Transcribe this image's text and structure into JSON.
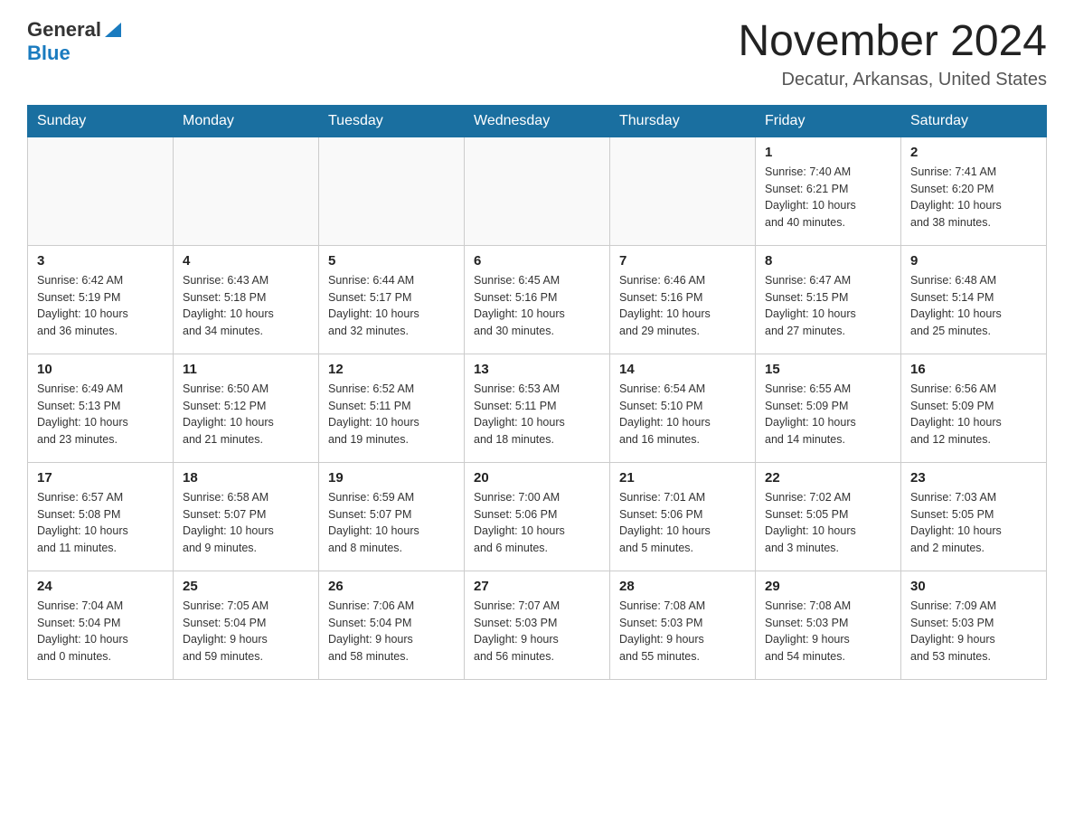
{
  "header": {
    "logo_general": "General",
    "logo_blue": "Blue",
    "title": "November 2024",
    "subtitle": "Decatur, Arkansas, United States"
  },
  "days_of_week": [
    "Sunday",
    "Monday",
    "Tuesday",
    "Wednesday",
    "Thursday",
    "Friday",
    "Saturday"
  ],
  "weeks": [
    [
      {
        "day": "",
        "info": ""
      },
      {
        "day": "",
        "info": ""
      },
      {
        "day": "",
        "info": ""
      },
      {
        "day": "",
        "info": ""
      },
      {
        "day": "",
        "info": ""
      },
      {
        "day": "1",
        "info": "Sunrise: 7:40 AM\nSunset: 6:21 PM\nDaylight: 10 hours\nand 40 minutes."
      },
      {
        "day": "2",
        "info": "Sunrise: 7:41 AM\nSunset: 6:20 PM\nDaylight: 10 hours\nand 38 minutes."
      }
    ],
    [
      {
        "day": "3",
        "info": "Sunrise: 6:42 AM\nSunset: 5:19 PM\nDaylight: 10 hours\nand 36 minutes."
      },
      {
        "day": "4",
        "info": "Sunrise: 6:43 AM\nSunset: 5:18 PM\nDaylight: 10 hours\nand 34 minutes."
      },
      {
        "day": "5",
        "info": "Sunrise: 6:44 AM\nSunset: 5:17 PM\nDaylight: 10 hours\nand 32 minutes."
      },
      {
        "day": "6",
        "info": "Sunrise: 6:45 AM\nSunset: 5:16 PM\nDaylight: 10 hours\nand 30 minutes."
      },
      {
        "day": "7",
        "info": "Sunrise: 6:46 AM\nSunset: 5:16 PM\nDaylight: 10 hours\nand 29 minutes."
      },
      {
        "day": "8",
        "info": "Sunrise: 6:47 AM\nSunset: 5:15 PM\nDaylight: 10 hours\nand 27 minutes."
      },
      {
        "day": "9",
        "info": "Sunrise: 6:48 AM\nSunset: 5:14 PM\nDaylight: 10 hours\nand 25 minutes."
      }
    ],
    [
      {
        "day": "10",
        "info": "Sunrise: 6:49 AM\nSunset: 5:13 PM\nDaylight: 10 hours\nand 23 minutes."
      },
      {
        "day": "11",
        "info": "Sunrise: 6:50 AM\nSunset: 5:12 PM\nDaylight: 10 hours\nand 21 minutes."
      },
      {
        "day": "12",
        "info": "Sunrise: 6:52 AM\nSunset: 5:11 PM\nDaylight: 10 hours\nand 19 minutes."
      },
      {
        "day": "13",
        "info": "Sunrise: 6:53 AM\nSunset: 5:11 PM\nDaylight: 10 hours\nand 18 minutes."
      },
      {
        "day": "14",
        "info": "Sunrise: 6:54 AM\nSunset: 5:10 PM\nDaylight: 10 hours\nand 16 minutes."
      },
      {
        "day": "15",
        "info": "Sunrise: 6:55 AM\nSunset: 5:09 PM\nDaylight: 10 hours\nand 14 minutes."
      },
      {
        "day": "16",
        "info": "Sunrise: 6:56 AM\nSunset: 5:09 PM\nDaylight: 10 hours\nand 12 minutes."
      }
    ],
    [
      {
        "day": "17",
        "info": "Sunrise: 6:57 AM\nSunset: 5:08 PM\nDaylight: 10 hours\nand 11 minutes."
      },
      {
        "day": "18",
        "info": "Sunrise: 6:58 AM\nSunset: 5:07 PM\nDaylight: 10 hours\nand 9 minutes."
      },
      {
        "day": "19",
        "info": "Sunrise: 6:59 AM\nSunset: 5:07 PM\nDaylight: 10 hours\nand 8 minutes."
      },
      {
        "day": "20",
        "info": "Sunrise: 7:00 AM\nSunset: 5:06 PM\nDaylight: 10 hours\nand 6 minutes."
      },
      {
        "day": "21",
        "info": "Sunrise: 7:01 AM\nSunset: 5:06 PM\nDaylight: 10 hours\nand 5 minutes."
      },
      {
        "day": "22",
        "info": "Sunrise: 7:02 AM\nSunset: 5:05 PM\nDaylight: 10 hours\nand 3 minutes."
      },
      {
        "day": "23",
        "info": "Sunrise: 7:03 AM\nSunset: 5:05 PM\nDaylight: 10 hours\nand 2 minutes."
      }
    ],
    [
      {
        "day": "24",
        "info": "Sunrise: 7:04 AM\nSunset: 5:04 PM\nDaylight: 10 hours\nand 0 minutes."
      },
      {
        "day": "25",
        "info": "Sunrise: 7:05 AM\nSunset: 5:04 PM\nDaylight: 9 hours\nand 59 minutes."
      },
      {
        "day": "26",
        "info": "Sunrise: 7:06 AM\nSunset: 5:04 PM\nDaylight: 9 hours\nand 58 minutes."
      },
      {
        "day": "27",
        "info": "Sunrise: 7:07 AM\nSunset: 5:03 PM\nDaylight: 9 hours\nand 56 minutes."
      },
      {
        "day": "28",
        "info": "Sunrise: 7:08 AM\nSunset: 5:03 PM\nDaylight: 9 hours\nand 55 minutes."
      },
      {
        "day": "29",
        "info": "Sunrise: 7:08 AM\nSunset: 5:03 PM\nDaylight: 9 hours\nand 54 minutes."
      },
      {
        "day": "30",
        "info": "Sunrise: 7:09 AM\nSunset: 5:03 PM\nDaylight: 9 hours\nand 53 minutes."
      }
    ]
  ]
}
